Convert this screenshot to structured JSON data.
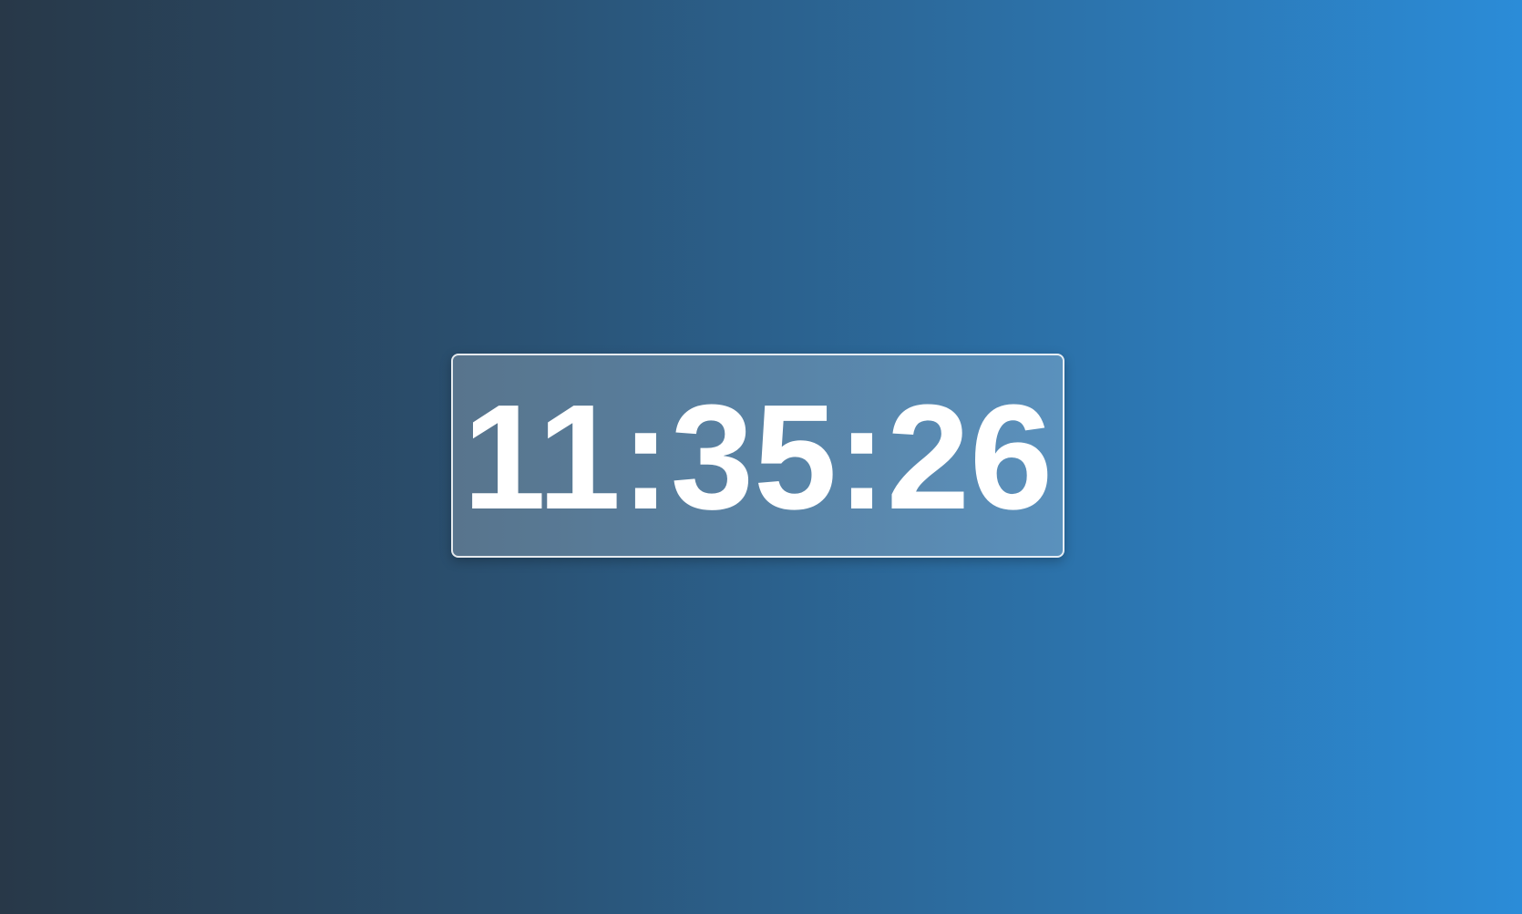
{
  "clock": {
    "time": "11:35:26"
  },
  "colors": {
    "background_start": "#283848",
    "background_end": "#2b8cd8",
    "text": "#ffffff",
    "panel_border": "#ffffff"
  }
}
